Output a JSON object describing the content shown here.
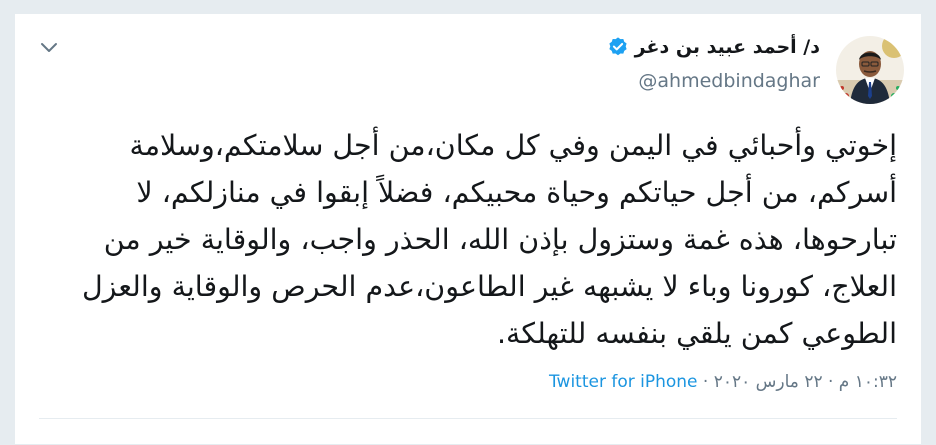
{
  "tweet": {
    "author": {
      "display_name": "د/ أحمد عبيد بن دغر",
      "handle": "@ahmedbindaghar",
      "verified": true
    },
    "lines": [
      "إخوتي وأحبائي في اليمن وفي كل مكان،من أجل سلامتكم،وسلامة",
      "أسركم، من أجل حياتكم وحياة محبيكم، فضلاً إبقوا في منازلكم، لا",
      "تبارحوها، هذه غمة وستزول بإذن الله، الحذر واجب، والوقاية خير من",
      "العلاج، كورونا وباء لا يشبهه غير الطاعون،عدم الحرص والوقاية والعزل",
      "الطوعي كمن يلقي بنفسه للتهلكة."
    ],
    "timestamp": "١٠:٣٢ م · ٢٢ مارس ٢٠٢٠",
    "separator": " · ",
    "source": "Twitter for iPhone"
  },
  "colors": {
    "background": "#e6ecf0",
    "card": "#ffffff",
    "text": "#14171a",
    "secondary": "#657786",
    "link": "#1b95e0",
    "verified_badge": "#1da1f2"
  },
  "icons": {
    "menu": "chevron-down-icon",
    "verified": "verified-badge-icon",
    "avatar": "profile-photo"
  }
}
